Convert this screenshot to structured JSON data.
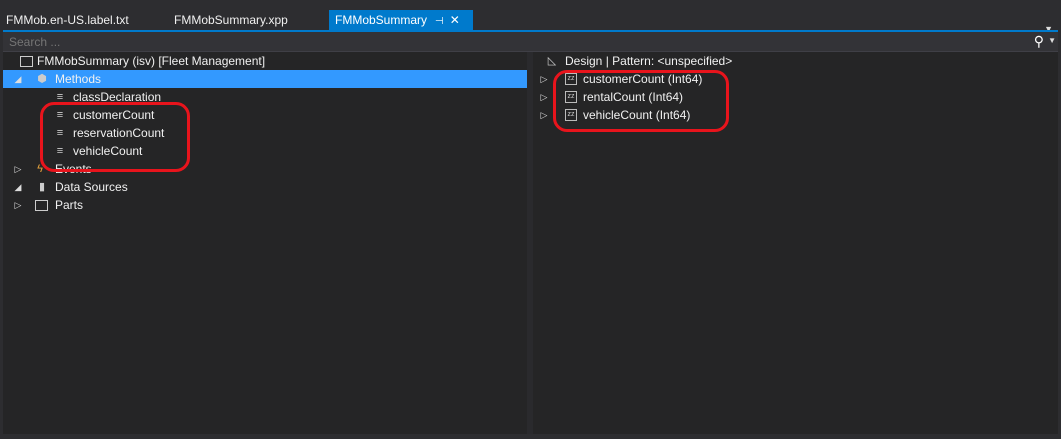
{
  "tabs": [
    {
      "label": "FMMob.en-US.label.txt"
    },
    {
      "label": "FMMobSummary.xpp"
    },
    {
      "label": "FMMobSummary",
      "active": true,
      "pin": "⊣",
      "close": "✕"
    }
  ],
  "search": {
    "placeholder": "Search ..."
  },
  "left_tree": {
    "root": "FMMobSummary (isv) [Fleet Management]",
    "methods": "Methods",
    "method_items": [
      "classDeclaration",
      "customerCount",
      "reservationCount",
      "vehicleCount"
    ],
    "events": "Events",
    "data_sources": "Data Sources",
    "parts": "Parts"
  },
  "right_tree": {
    "design": "Design | Pattern: <unspecified>",
    "fields": [
      "customerCount (Int64)",
      "rentalCount (Int64)",
      "vehicleCount (Int64)"
    ],
    "field_icon_text": "zz"
  },
  "colors": {
    "accent": "#007acc",
    "selection": "#3399ff",
    "highlight_ring": "#e8141c"
  }
}
